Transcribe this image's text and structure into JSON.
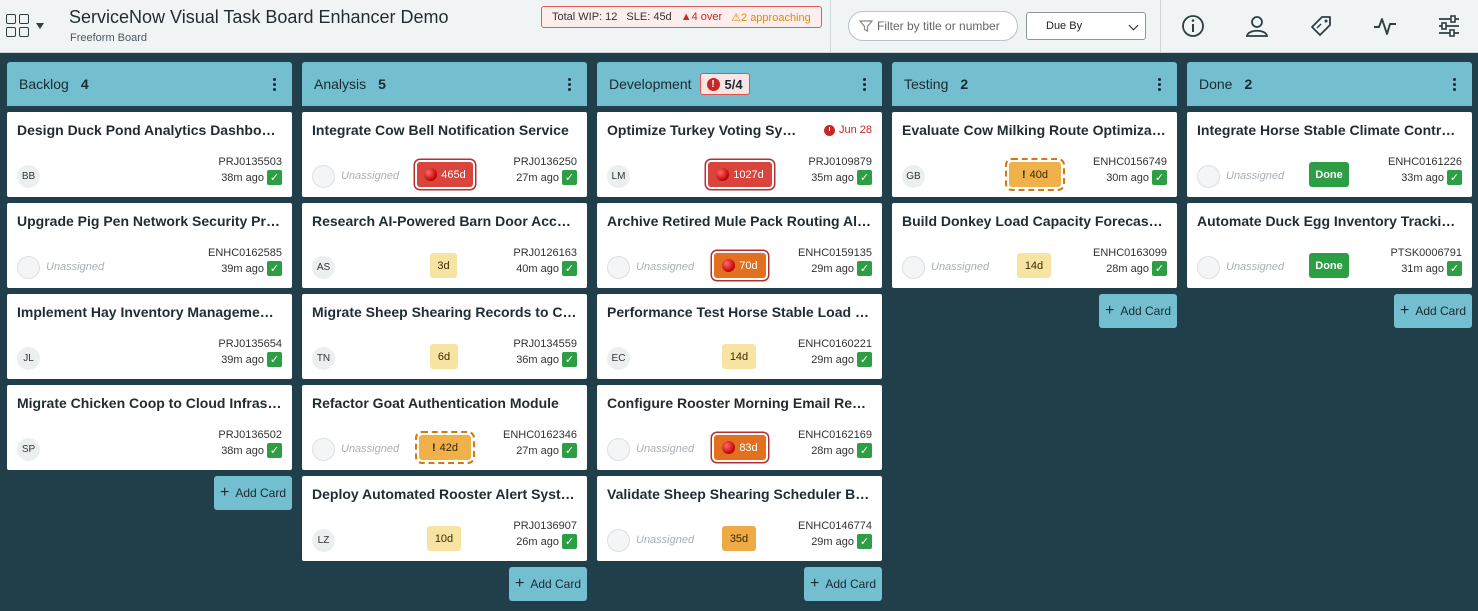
{
  "header": {
    "title": "ServiceNow Visual Task Board Enhancer Demo",
    "subtitle": "Freeform Board",
    "wip": {
      "total": "Total WIP: 12",
      "sle": "SLE: 45d",
      "over": "▲4 over",
      "approaching": "⚠2 approaching"
    },
    "filter_placeholder": "Filter by title or number",
    "sort_value": "Due By",
    "icons": [
      "info-icon",
      "user-icon",
      "tag-icon",
      "activity-icon",
      "settings-sliders-icon"
    ]
  },
  "add_card_label": "Add Card",
  "columns": [
    {
      "name": "Backlog",
      "count": "4",
      "cards": [
        {
          "title": "Design Duck Pond Analytics Dashboard",
          "avatar": "BB",
          "number": "PRJ0135503",
          "age": "38m ago"
        },
        {
          "title": "Upgrade Pig Pen Network Security Protocols",
          "assignee": "Unassigned",
          "number": "ENHC0162585",
          "age": "39m ago"
        },
        {
          "title": "Implement Hay Inventory Management System",
          "avatar": "JL",
          "number": "PRJ0135654",
          "age": "39m ago"
        },
        {
          "title": "Migrate Chicken Coop to Cloud Infrastructure",
          "avatar": "SP",
          "number": "PRJ0136502",
          "age": "38m ago"
        }
      ]
    },
    {
      "name": "Analysis",
      "count": "5",
      "cards": [
        {
          "title": "Integrate Cow Bell Notification Service",
          "assignee": "Unassigned",
          "badge": "465d",
          "number": "PRJ0136250",
          "age": "27m ago"
        },
        {
          "title": "Research AI-Powered Barn Door Access Control",
          "avatar": "AS",
          "badge": "3d",
          "number": "PRJ0126163",
          "age": "40m ago"
        },
        {
          "title": "Migrate Sheep Shearing Records to Cloud Storage",
          "avatar": "TN",
          "badge": "6d",
          "number": "PRJ0134559",
          "age": "36m ago"
        },
        {
          "title": "Refactor Goat Authentication Module",
          "assignee": "Unassigned",
          "badge": "42d",
          "number": "ENHC0162346",
          "age": "27m ago"
        },
        {
          "title": "Deploy Automated Rooster Alert System",
          "avatar": "LZ",
          "badge": "10d",
          "number": "PRJ0136907",
          "age": "26m ago"
        }
      ]
    },
    {
      "name": "Development",
      "wip": "5/4",
      "cards": [
        {
          "title": "Optimize Turkey Voting System Performance",
          "due": "Jun 28",
          "avatar": "LM",
          "badge": "1027d",
          "number": "PRJ0109879",
          "age": "35m ago"
        },
        {
          "title": "Archive Retired Mule Pack Routing Algorithms",
          "assignee": "Unassigned",
          "badge": "70d",
          "number": "ENHC0159135",
          "age": "29m ago"
        },
        {
          "title": "Performance Test Horse Stable Load Balancer",
          "avatar": "EC",
          "badge": "14d",
          "number": "ENHC0160221",
          "age": "29m ago"
        },
        {
          "title": "Configure Rooster Morning Email Reports",
          "assignee": "Unassigned",
          "badge": "83d",
          "number": "ENHC0162169",
          "age": "28m ago"
        },
        {
          "title": "Validate Sheep Shearing Scheduler Business Rules",
          "assignee": "Unassigned",
          "badge": "35d",
          "number": "ENHC0146774",
          "age": "29m ago"
        }
      ]
    },
    {
      "name": "Testing",
      "count": "2",
      "cards": [
        {
          "title": "Evaluate Cow Milking Route Optimization",
          "avatar": "GB",
          "badge": "40d",
          "number": "ENHC0156749",
          "age": "30m ago"
        },
        {
          "title": "Build Donkey Load Capacity Forecasting Model",
          "assignee": "Unassigned",
          "badge": "14d",
          "number": "ENHC0163099",
          "age": "28m ago"
        }
      ]
    },
    {
      "name": "Done",
      "count": "2",
      "cards": [
        {
          "title": "Integrate Horse Stable Climate Control System",
          "assignee": "Unassigned",
          "badge": "Done",
          "number": "ENHC0161226",
          "age": "33m ago"
        },
        {
          "title": "Automate Duck Egg Inventory Tracking Service",
          "assignee": "Unassigned",
          "badge": "Done",
          "number": "PTSK0006791",
          "age": "31m ago"
        }
      ]
    }
  ]
}
